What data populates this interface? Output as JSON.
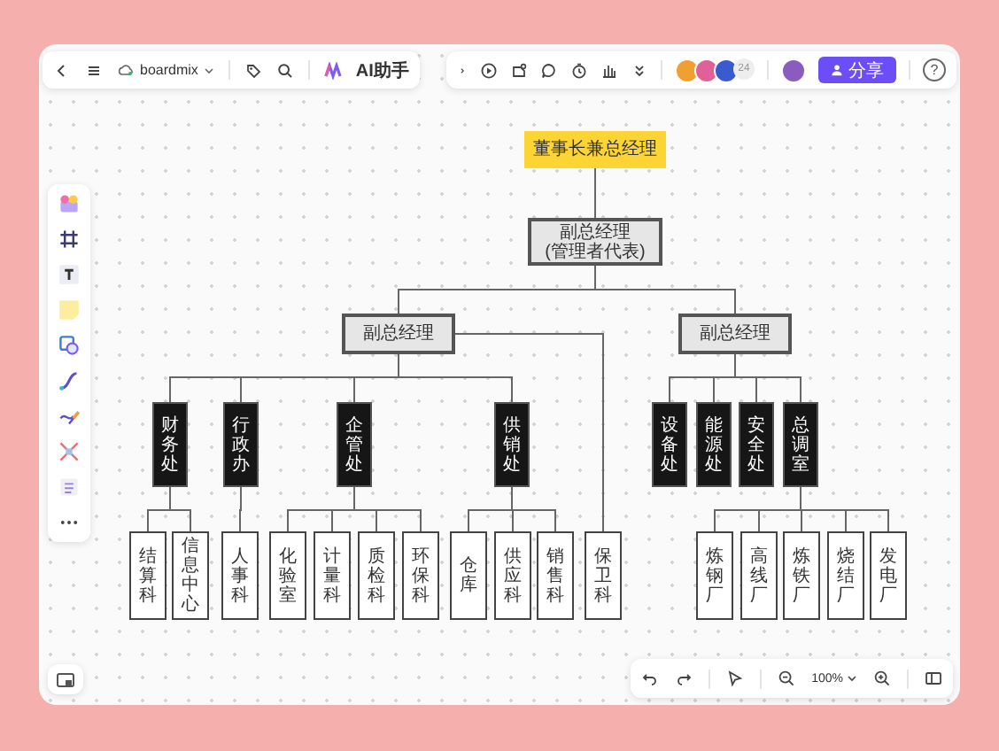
{
  "top_left_toolbar": {
    "doc_name": "boardmix",
    "ai_label": "AI助手"
  },
  "top_right_toolbar": {
    "collaborator_count": "24",
    "share_label": "分享",
    "help_label": "?"
  },
  "zoom_controls": {
    "zoom_level": "100%"
  },
  "org_chart": {
    "text": "董事长兼总经理",
    "kind": "top",
    "children": [
      {
        "text": "副总经理",
        "subtext": "(管理者代表)",
        "kind": "manager",
        "children": [
          {
            "text": "副总经理",
            "kind": "manager",
            "children": [
              {
                "text": "财务处",
                "kind": "dept",
                "children": [
                  {
                    "text": "结算科",
                    "kind": "section"
                  },
                  {
                    "text": "信息中心",
                    "kind": "section"
                  }
                ]
              },
              {
                "text": "行政办",
                "kind": "dept",
                "children": [
                  {
                    "text": "人事科",
                    "kind": "section"
                  }
                ]
              },
              {
                "text": "企管处",
                "kind": "dept",
                "children": [
                  {
                    "text": "化验室",
                    "kind": "section"
                  },
                  {
                    "text": "计量科",
                    "kind": "section"
                  },
                  {
                    "text": "质检科",
                    "kind": "section"
                  },
                  {
                    "text": "环保科",
                    "kind": "section"
                  }
                ]
              },
              {
                "text": "供销处",
                "kind": "dept",
                "children": [
                  {
                    "text": "仓库",
                    "kind": "section"
                  },
                  {
                    "text": "供应科",
                    "kind": "section"
                  },
                  {
                    "text": "销售科",
                    "kind": "section"
                  }
                ]
              },
              {
                "text": "保卫科",
                "kind": "section"
              }
            ]
          },
          {
            "text": "副总经理",
            "kind": "manager",
            "children": [
              {
                "text": "设备处",
                "kind": "dept"
              },
              {
                "text": "能源处",
                "kind": "dept"
              },
              {
                "text": "安全处",
                "kind": "dept"
              },
              {
                "text": "总调室",
                "kind": "dept",
                "children": [
                  {
                    "text": "炼钢厂",
                    "kind": "section"
                  },
                  {
                    "text": "高线厂",
                    "kind": "section"
                  },
                  {
                    "text": "炼铁厂",
                    "kind": "section"
                  },
                  {
                    "text": "烧结厂",
                    "kind": "section"
                  },
                  {
                    "text": "发电厂",
                    "kind": "section"
                  }
                ]
              }
            ]
          }
        ]
      }
    ]
  }
}
